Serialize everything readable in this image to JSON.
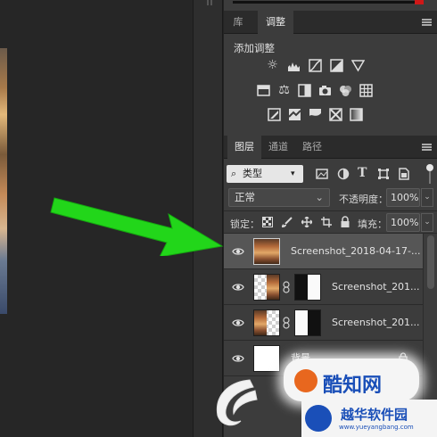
{
  "colors": {
    "panel_bg": "#3c3c3c",
    "tab_bar_bg": "#2b2b2b",
    "selected_row": "#565656",
    "arrow_green": "#22d61a",
    "watermark_orange": "#e8671e",
    "watermark_blue": "#1a4fb8"
  },
  "library_panel": {
    "tabs": [
      {
        "label": "库",
        "active": false
      },
      {
        "label": "调整",
        "active": true
      }
    ]
  },
  "adjustments": {
    "title": "添加调整",
    "icons": [
      "brightness-contrast-icon",
      "levels-icon",
      "curves-icon",
      "exposure-icon",
      "vibrance-icon",
      "hue-saturation-icon",
      "color-balance-icon",
      "black-white-icon",
      "photo-filter-icon",
      "channel-mixer-icon",
      "color-lookup-icon",
      "invert-icon",
      "posterize-icon",
      "threshold-icon",
      "selective-color-icon",
      "gradient-map-icon"
    ]
  },
  "layers_panel": {
    "tabs": [
      {
        "label": "图层",
        "active": true
      },
      {
        "label": "通道",
        "active": false
      },
      {
        "label": "路径",
        "active": false
      }
    ],
    "filter_kind": "类型",
    "blend_mode": "正常",
    "opacity_label": "不透明度：",
    "opacity_value": "100%",
    "lock_label": "锁定：",
    "fill_label": "填充：",
    "fill_value": "100%",
    "layers": [
      {
        "name": "Screenshot_2018-04-17-...",
        "selected": true
      },
      {
        "name": "Screenshot_201...",
        "selected": false
      },
      {
        "name": "Screenshot_201...",
        "selected": false
      },
      {
        "name": "背景",
        "selected": false
      }
    ]
  },
  "watermarks": {
    "center": "酷知网",
    "bottom_cn": "越华软件园",
    "bottom_url": "www.yueyangbang.com"
  }
}
